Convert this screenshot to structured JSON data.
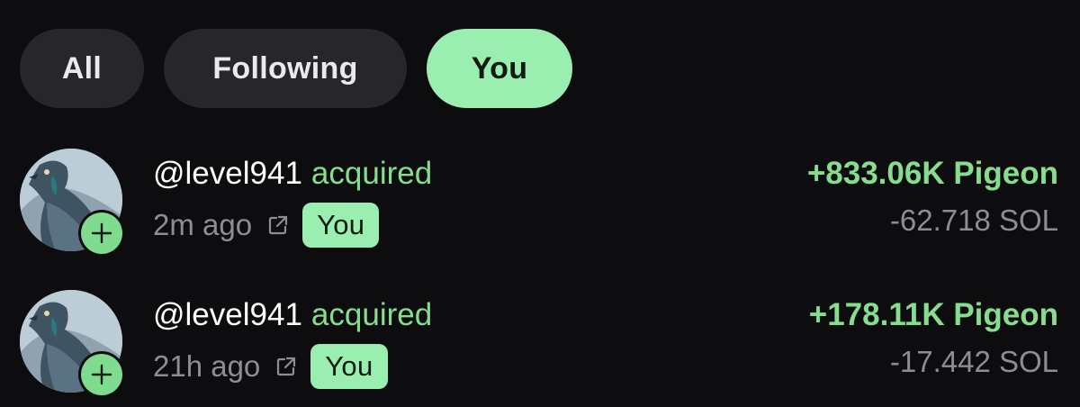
{
  "tabs": [
    {
      "label": "All",
      "active": false
    },
    {
      "label": "Following",
      "active": false
    },
    {
      "label": "You",
      "active": true
    }
  ],
  "colors": {
    "background": "#0d0d10",
    "tab_inactive": "#26262b",
    "accent": "#9aeeb0",
    "positive": "#86dd8d",
    "muted": "#8d8d94"
  },
  "activity": [
    {
      "handle": "@level941",
      "action": "acquired",
      "time": "2m ago",
      "badge": "You",
      "token_amount": "+833.06K Pigeon",
      "sol_amount": "-62.718 SOL",
      "avatar_icon": "pigeon-avatar",
      "link_icon": "external-link-icon"
    },
    {
      "handle": "@level941",
      "action": "acquired",
      "time": "21h ago",
      "badge": "You",
      "token_amount": "+178.11K Pigeon",
      "sol_amount": "-17.442 SOL",
      "avatar_icon": "pigeon-avatar",
      "link_icon": "external-link-icon"
    }
  ]
}
